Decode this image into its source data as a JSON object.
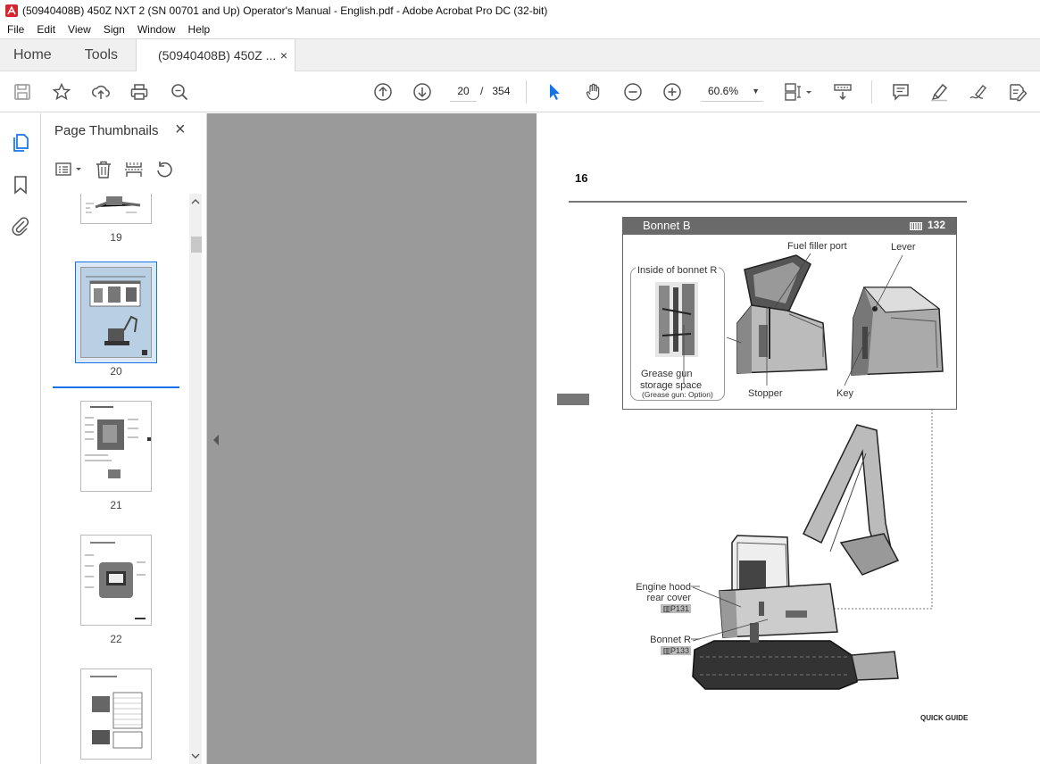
{
  "window": {
    "title": "(50940408B) 450Z NXT 2 (SN 00701 and Up) Operator's Manual - English.pdf - Adobe Acrobat Pro DC (32-bit)"
  },
  "menu": [
    "File",
    "Edit",
    "View",
    "Sign",
    "Window",
    "Help"
  ],
  "tabs": {
    "home": "Home",
    "tools": "Tools",
    "document": "(50940408B) 450Z ...",
    "close": "×"
  },
  "toolbar": {
    "current_page": "20",
    "page_sep": "/",
    "total_pages": "354",
    "zoom": "60.6%",
    "icons": [
      "save-icon",
      "bookmark-star-icon",
      "upload-icon",
      "print-icon",
      "search-icon",
      "page-up-icon",
      "page-down-icon",
      "select-cursor-icon",
      "hand-icon",
      "zoom-out-icon",
      "zoom-in-icon",
      "fit-page-icon",
      "scroll-mode-icon",
      "comment-icon",
      "highlight-icon",
      "sign-icon",
      "edit-pdf-icon"
    ]
  },
  "panel": {
    "title": "Page Thumbnails",
    "close": "×",
    "thumbnails": [
      {
        "label": "19"
      },
      {
        "label": "20",
        "selected": true
      },
      {
        "label": "21"
      },
      {
        "label": "22"
      },
      {
        "label": ""
      }
    ]
  },
  "page": {
    "number": "16",
    "bonnet": {
      "title": "Bonnet B",
      "ref": "132",
      "inside_label": "Inside of bonnet R",
      "grease_line1": "Grease gun",
      "grease_line2": "storage space",
      "grease_note": "(Grease gun: Option)",
      "fuel_label": "Fuel filler port",
      "lever_label": "Lever",
      "stopper_label": "Stopper",
      "key_label": "Key"
    },
    "engine_hood_line1": "Engine hood",
    "engine_hood_line2": "rear cover",
    "engine_hood_ref": "P131",
    "bonnet_r_label": "Bonnet R",
    "bonnet_r_ref": "P133",
    "footer": "QUICK GUIDE"
  },
  "colors": {
    "acrobat_red": "#d4262c",
    "accent_blue": "#1473e6",
    "canvas_gray": "#9a9a9a"
  }
}
